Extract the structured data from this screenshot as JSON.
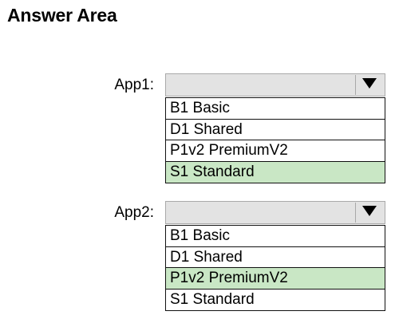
{
  "title": "Answer Area",
  "colors": {
    "selected_option_bg": "#c9e7c5",
    "dropdown_head_bg": "#e3e3e3"
  },
  "app1": {
    "label": "App1:",
    "options": [
      "B1 Basic",
      "D1 Shared",
      "P1v2 PremiumV2",
      "S1 Standard"
    ],
    "selected": "S1 Standard"
  },
  "app2": {
    "label": "App2:",
    "options": [
      "B1 Basic",
      "D1 Shared",
      "P1v2 PremiumV2",
      "S1 Standard"
    ],
    "selected": "P1v2 PremiumV2"
  },
  "icons": {
    "dropdown_arrow": "triangle-down-icon"
  }
}
